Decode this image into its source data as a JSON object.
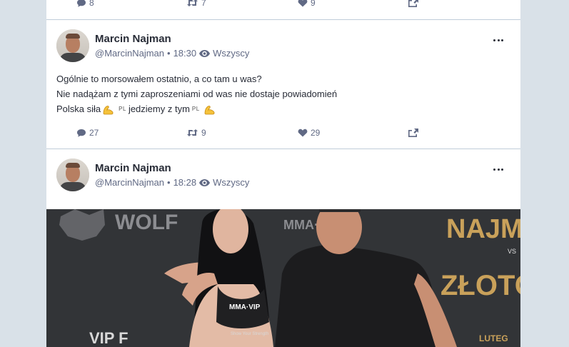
{
  "top_status": {
    "replies": "8",
    "reblogs": "7",
    "favourites": "9"
  },
  "status1": {
    "name": "Marcin Najman",
    "handle": "@MarcinNajman",
    "time": "18:30",
    "visibility": "Wszyscy",
    "lines": {
      "l1": "Ogólnie to morsowałem ostatnio, a co tam u was?",
      "l2": "Nie nadążam z tymi zaproszeniami od was nie dostaje powiadomień",
      "l3a": "Polska siła",
      "flag1": "PL",
      "l3b": "jedziemy z tym",
      "flag2": "PL"
    },
    "replies": "27",
    "reblogs": "9",
    "favourites": "29"
  },
  "status2": {
    "name": "Marcin Najman",
    "handle": "@MarcinNajman",
    "time": "18:28",
    "visibility": "Wszyscy",
    "media_text": {
      "wolf": "WOLF",
      "mma_vip": "MMA·VIP",
      "mma_sl": "MMA·S·PL",
      "naj": "NAJM",
      "vs": "VS",
      "zloto": "ZŁOTO",
      "show": "Show Your Strength",
      "vip_fight": "VIP F",
      "lutego": "LUTEG"
    }
  },
  "colors": {
    "page_bg": "#d9e1e8",
    "text": "#282c37",
    "muted": "#606984",
    "divider": "#c0cdd9",
    "emoji": "#f5c23b"
  },
  "icons": [
    "reply-icon",
    "reblog-icon",
    "star-icon",
    "share-icon",
    "eye-icon",
    "more-icon",
    "flex-emoji-icon"
  ],
  "sep": "•"
}
